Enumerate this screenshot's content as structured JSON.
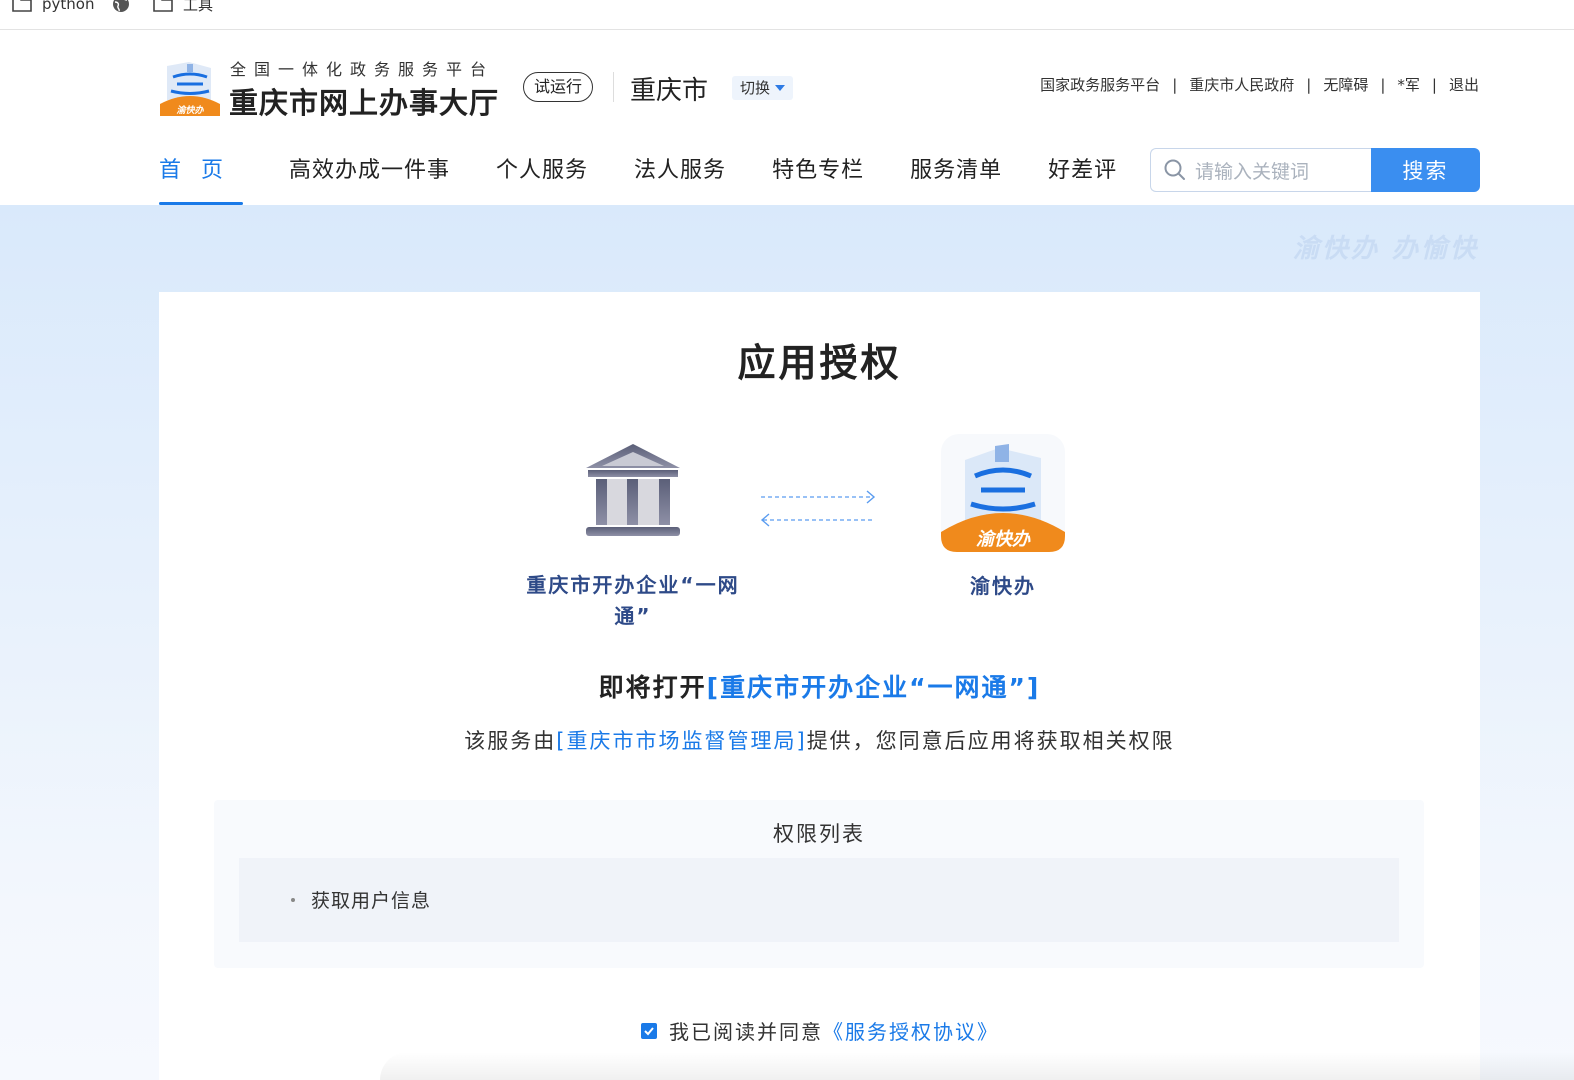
{
  "bookmarks": {
    "items": [
      {
        "label": "python",
        "icon": "folder-icon"
      },
      {
        "label": "",
        "icon": "globe-icon"
      },
      {
        "label": "工具",
        "icon": "folder-icon"
      }
    ]
  },
  "header": {
    "brand_sub": "全国一体化政务服务平台",
    "brand_main": "重庆市网上办事大厅",
    "trial_badge": "试运行",
    "city": "重庆市",
    "switch_label": "切换",
    "top_links": [
      "国家政务服务平台",
      "重庆市人民政府",
      "无障碍",
      "*军",
      "退出"
    ],
    "separator": "|"
  },
  "nav": {
    "items": [
      "首页",
      "高效办成一件事",
      "个人服务",
      "法人服务",
      "特色专栏",
      "服务清单",
      "好差评"
    ],
    "active_index": 0
  },
  "search": {
    "placeholder": "请输入关键词",
    "button_label": "搜索"
  },
  "banner": {
    "slogan": "渝快办  办愉快"
  },
  "auth": {
    "title": "应用授权",
    "left_app_name": "重庆市开办企业“一网通”",
    "right_app_name": "渝快办",
    "open_prefix": "即将打开",
    "open_target": "[重庆市开办企业“一网通”]",
    "provider_prefix": "该服务由",
    "provider_name": "[重庆市市场监督管理局]",
    "provider_suffix": "提供，您同意后应用将获取相关权限",
    "permissions_title": "权限列表",
    "permissions": [
      "获取用户信息"
    ],
    "agree_text": "我已阅读并同意",
    "agree_link": "《服务授权协议》",
    "agree_checked": true
  },
  "colors": {
    "accent": "#1a7ae8",
    "search_button": "#3a8ef0",
    "app_name": "#2e4a88",
    "logo_orange": "#f08a1c"
  }
}
